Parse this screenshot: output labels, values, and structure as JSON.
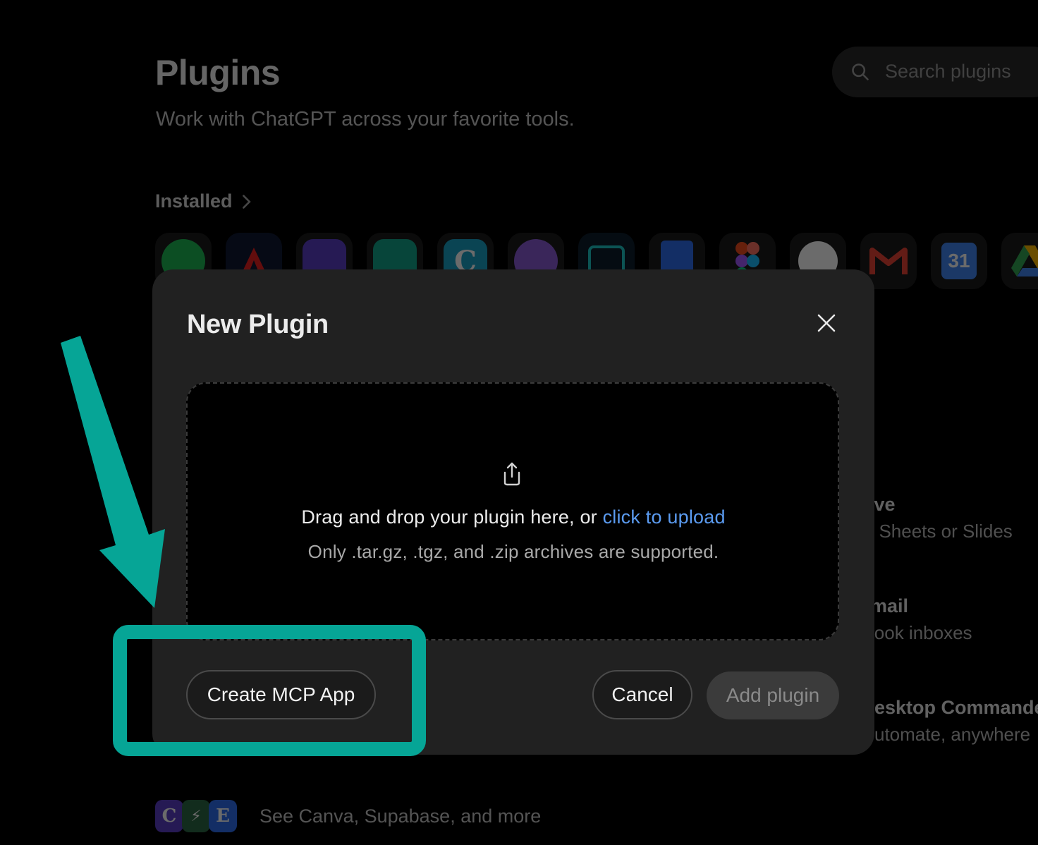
{
  "background": {
    "title": "Plugins",
    "subtitle": "Work with ChatGPT across your favorite tools.",
    "search_placeholder": "Search plugins",
    "installed_label": "Installed",
    "installed_icons": [
      {
        "name": "spotify-icon",
        "color": "#1db954"
      },
      {
        "name": "adobe-icon",
        "color": "#ea1f1f",
        "bg": "#0f1830"
      },
      {
        "name": "storage-icon",
        "color": "#5b3fc9"
      },
      {
        "name": "robot-icon",
        "color": "#12a58a"
      },
      {
        "name": "canva-icon",
        "color": "#1aa2c7",
        "glyph": "C"
      },
      {
        "name": "cookie-icon",
        "color": "#8b5cd6"
      },
      {
        "name": "bot-icon",
        "color": "#1ec9c9",
        "bg": "#0d1d2b"
      },
      {
        "name": "google-docs-icon",
        "color": "#2f6ff0"
      },
      {
        "name": "figma-icon",
        "color": "#f24e1e"
      },
      {
        "name": "github-icon",
        "color": "#ffffff"
      },
      {
        "name": "gmail-icon",
        "color": "#ea4335"
      },
      {
        "name": "google-calendar-icon",
        "color": "#4285f4",
        "glyph": "31"
      },
      {
        "name": "google-drive-icon",
        "color": "#34a853"
      }
    ],
    "rows": [
      {
        "name": "ive",
        "desc": ", Sheets or Slides"
      },
      {
        "name": "mail",
        "desc": "look inboxes"
      },
      {
        "name": "esktop Commande",
        "desc": "utomate, anywhere"
      }
    ],
    "footer_text": "See Canva, Supabase, and more",
    "footer_chips": [
      "C",
      "⚡",
      "E"
    ]
  },
  "modal": {
    "title": "New Plugin",
    "drop_text": "Drag and drop your plugin here, or ",
    "drop_link": "click to upload",
    "drop_hint": "Only .tar.gz, .tgz, and .zip archives are supported.",
    "create_button": "Create MCP App",
    "cancel_button": "Cancel",
    "add_button": "Add plugin"
  },
  "colors": {
    "annotation": "#06a596",
    "link": "#5b9bf0",
    "modal_bg": "#212121"
  }
}
